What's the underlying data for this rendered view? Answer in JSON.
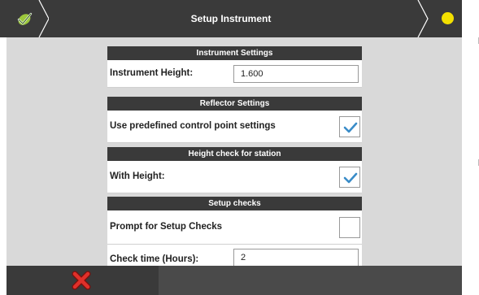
{
  "header": {
    "title": "Setup Instrument",
    "back_icon": "check-leaf-icon",
    "status_icon": "yellow-dot-icon",
    "status_color": "#f3e000"
  },
  "sections": {
    "instrument": {
      "header": "Instrument Settings",
      "height_label": "Instrument Height:",
      "height_value": "1.600"
    },
    "reflector": {
      "header": "Reflector Settings",
      "predefined_label": "Use predefined control point settings",
      "predefined_checked": true
    },
    "height_check": {
      "header": "Height check for station",
      "with_height_label": "With Height:",
      "with_height_checked": true
    },
    "setup_checks": {
      "header": "Setup checks",
      "prompt_label": "Prompt for Setup Checks",
      "prompt_checked": false,
      "check_time_label": "Check time (Hours):",
      "check_time_value": "2"
    }
  },
  "footer": {
    "cancel_icon": "red-x-icon",
    "cancel_color": "#e0302a"
  },
  "colors": {
    "bar": "#3a3a3a",
    "panel_bg": "#d9d9d9",
    "check_blue": "#3a8cc8"
  }
}
